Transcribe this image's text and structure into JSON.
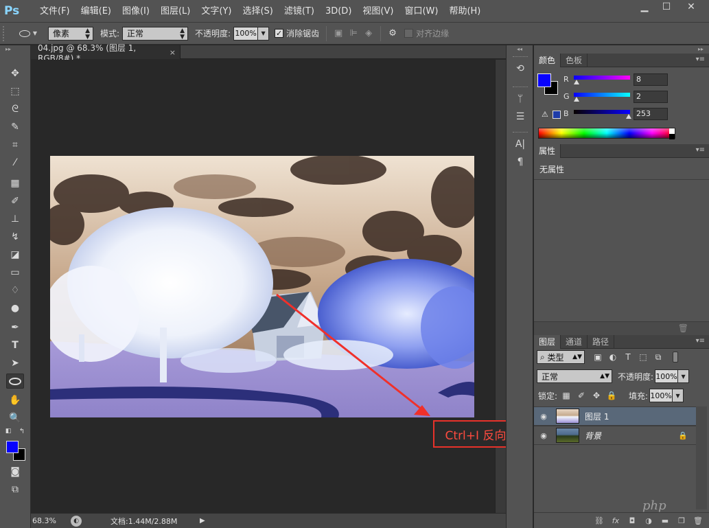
{
  "app": {
    "logo": "Ps"
  },
  "menu": [
    "文件(F)",
    "编辑(E)",
    "图像(I)",
    "图层(L)",
    "文字(Y)",
    "选择(S)",
    "滤镜(T)",
    "3D(D)",
    "视图(V)",
    "窗口(W)",
    "帮助(H)"
  ],
  "window_controls": {
    "minimize": "▁",
    "maximize": "☐",
    "close": "✕"
  },
  "options": {
    "pixel_mode": "像素",
    "mode_label": "模式:",
    "mode_value": "正常",
    "opacity_label": "不透明度:",
    "opacity_value": "100%",
    "antialias_checked": true,
    "antialias_label": "消除锯齿",
    "align_edges_label": "对齐边缘",
    "align_edges_checked": false
  },
  "document": {
    "tab_title": "04.jpg @ 68.3% (图层 1, RGB/8#) *",
    "close": "×",
    "zoom": "68.3%",
    "doc_info": "文档:1.44M/2.88M"
  },
  "annotation": {
    "text": "Ctrl+I 反向",
    "color": "#e8322a"
  },
  "color_panel": {
    "tabs": [
      "颜色",
      "色板"
    ],
    "fg_color": "#0802fd",
    "bg_color": "#000000",
    "r_label": "R",
    "r_value": "8",
    "g_label": "G",
    "g_value": "2",
    "b_label": "B",
    "b_value": "253"
  },
  "properties_panel": {
    "tab": "属性",
    "body": "无属性"
  },
  "layers_panel": {
    "tabs": [
      "图层",
      "通道",
      "路径"
    ],
    "kind_label": "类型",
    "blend_mode": "正常",
    "opacity_label": "不透明度:",
    "opacity_value": "100%",
    "lock_label": "锁定:",
    "fill_label": "填充:",
    "fill_value": "100%",
    "layers": [
      {
        "name": "图层 1",
        "selected": true,
        "locked": false
      },
      {
        "name": "背景",
        "selected": false,
        "locked": true
      }
    ]
  },
  "watermark": "php"
}
